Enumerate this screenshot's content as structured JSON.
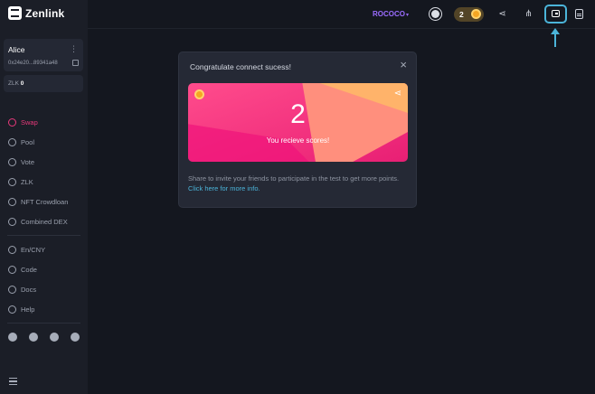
{
  "app": {
    "logo_text": "Zenlink"
  },
  "account": {
    "name": "Alice",
    "address": "0x24e20...89341a48",
    "balance_label": "ZLK",
    "balance_value": "0"
  },
  "sidebar": {
    "items": [
      {
        "label": "Swap",
        "icon": "swap-icon",
        "active": true
      },
      {
        "label": "Pool",
        "icon": "pool-icon"
      },
      {
        "label": "Vote",
        "icon": "vote-icon"
      },
      {
        "label": "ZLK",
        "icon": "zlk-icon"
      },
      {
        "label": "NFT Crowdloan",
        "icon": "nft-icon"
      },
      {
        "label": "Combined DEX",
        "icon": "dex-icon"
      }
    ],
    "secondary": [
      {
        "label": "En/CNY",
        "icon": "language-icon"
      },
      {
        "label": "Code",
        "icon": "code-icon"
      },
      {
        "label": "Docs",
        "icon": "docs-icon"
      },
      {
        "label": "Help",
        "icon": "help-icon"
      }
    ]
  },
  "header": {
    "network": "ROCOCO",
    "score": "2"
  },
  "modal": {
    "title": "Congratulate connect sucess!",
    "close": "×",
    "score": "2",
    "score_text": "You recieve scores!",
    "desc": "Share to invite your friends to participate in the test to get more points.",
    "link": "Click here for more info."
  },
  "colors": {
    "accent": "#e8397a",
    "network": "#9b6cff",
    "highlight": "#4bb4d9",
    "bg": "#14171f",
    "sidebar": "#1b1e27"
  }
}
